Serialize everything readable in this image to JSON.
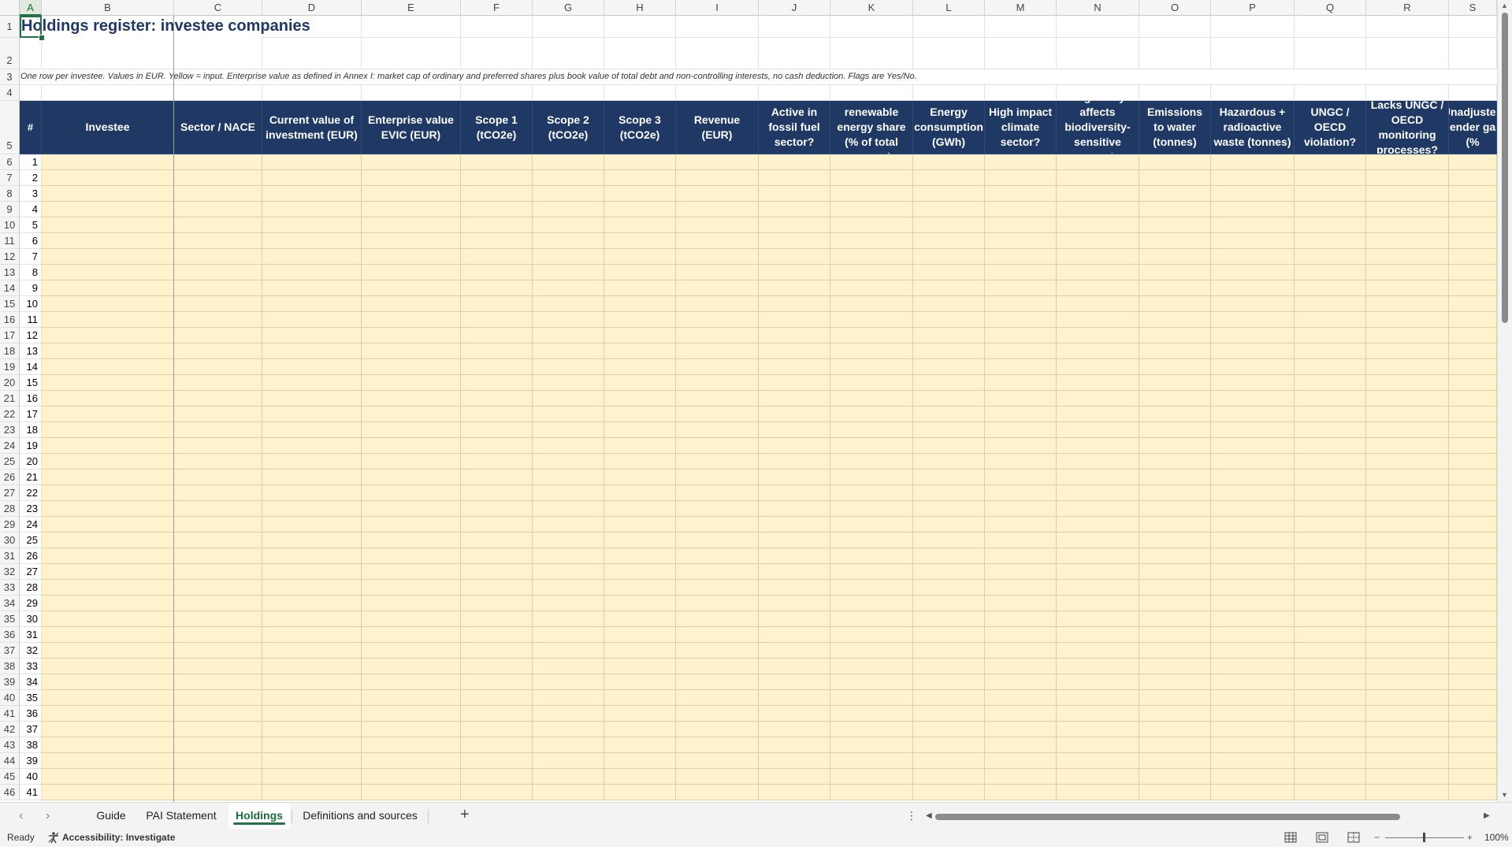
{
  "sheet": {
    "columns": [
      "A",
      "B",
      "C",
      "D",
      "E",
      "F",
      "G",
      "H",
      "I",
      "J",
      "K",
      "L",
      "M",
      "N",
      "O",
      "P",
      "Q",
      "R",
      "S"
    ],
    "selected_column": "A",
    "title": "Holdings register: investee companies",
    "note": "One row per investee. Values in EUR. Yellow = input. Enterprise value as defined in Annex I: market cap of ordinary and preferred shares plus book value of total debt and non-controlling interests, no cash deduction. Flags are Yes/No.",
    "headers": [
      "#",
      "Investee",
      "Sector / NACE",
      "Current value of investment (EUR)",
      "Enterprise value EVIC (EUR)",
      "Scope 1 (tCO2e)",
      "Scope 2 (tCO2e)",
      "Scope 3 (tCO2e)",
      "Revenue (EUR)",
      "Active in fossil fuel sector?",
      "Non-renewable energy share (% of total energy)",
      "Energy consumption (GWh)",
      "High impact climate sector?",
      "Negatively affects biodiversity-sensitive areas?",
      "Emissions to water (tonnes)",
      "Hazardous + radioactive waste (tonnes)",
      "UNGC / OECD violation?",
      "Lacks UNGC / OECD monitoring processes?",
      "Unadjusted gender gap (%"
    ],
    "row_numbers": [
      "1",
      "2",
      "3",
      "4",
      "5",
      "6",
      "7",
      "8",
      "9",
      "10",
      "11",
      "12",
      "13",
      "14",
      "15",
      "16",
      "17",
      "18",
      "19",
      "20",
      "21",
      "22",
      "23",
      "24",
      "25",
      "26",
      "27",
      "28",
      "29",
      "30",
      "31",
      "32",
      "33",
      "34",
      "35",
      "36",
      "37",
      "38",
      "39",
      "40",
      "41",
      "42",
      "43",
      "44",
      "45",
      "46"
    ],
    "item_numbers": [
      "1",
      "2",
      "3",
      "4",
      "5",
      "6",
      "7",
      "8",
      "9",
      "10",
      "11",
      "12",
      "13",
      "14",
      "15",
      "16",
      "17",
      "18",
      "19",
      "20",
      "21",
      "22",
      "23",
      "24",
      "25",
      "26",
      "27",
      "28",
      "29",
      "30",
      "31",
      "32",
      "33",
      "34",
      "35",
      "36",
      "37",
      "38",
      "39",
      "40",
      "41"
    ]
  },
  "tabs": [
    {
      "label": "Guide",
      "active": false
    },
    {
      "label": "PAI Statement",
      "active": false
    },
    {
      "label": "Holdings",
      "active": true
    },
    {
      "label": "Definitions and sources",
      "active": false
    }
  ],
  "status": {
    "ready": "Ready",
    "accessibility": "Accessibility: Investigate",
    "zoom": "100%"
  },
  "colors": {
    "header_fill": "#1f3864",
    "input_fill": "#fff2cc",
    "accent": "#217346"
  }
}
